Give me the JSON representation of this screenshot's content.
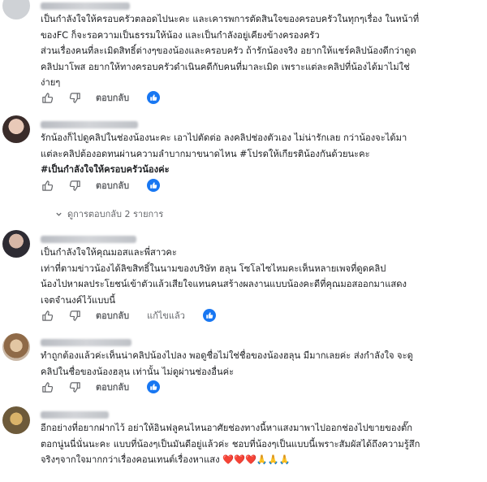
{
  "comments": [
    {
      "lines": [
        {
          "text": "เป็นกำลังใจให้ครอบครัวตลอดไปนะคะ และเคารพการตัดสินใจของครอบครัวในทุกๆเรื่อง ในหน้าที่",
          "bold": false
        },
        {
          "text": "ของFC ก็จะรอความเป็นธรรมให้น้อง และเป็นกำลังอยู่เคียงข้างครองครัว",
          "bold": false
        },
        {
          "text": "ส่วนเรื่องคนที่ละเมิดสิทธิ์ต่างๆของน้องและครอบครัว ถ้ารักน้องจริง อยากให้แชร์คลิปน้องดีกว่าดูด",
          "bold": false
        },
        {
          "text": "คลิปมาโพส อยากให้ทางครอบครัวดำเนินคดีกับคนที่มาละเมิด เพราะแต่ละคลิปที่น้องได้มาไม่ใช่",
          "bold": false
        },
        {
          "text": "ง่ายๆ",
          "bold": false
        }
      ],
      "reply_label": "ตอบกลับ"
    },
    {
      "lines": [
        {
          "text": "รักน้องก็ไปดูคลิปในช่องน้องนะคะ เอาไปตัดต่อ ลงคลิปช่องตัวเอง ไม่น่ารักเลย กว่าน้องจะได้มา",
          "bold": false
        },
        {
          "text": "แต่ละคลิปต้องอดทนผ่านความลำบากมาขนาดไหน #โปรดให้เกียรติน้องกันด้วยนะคะ",
          "bold": false
        },
        {
          "text": "#เป็นกำลังใจให้ครอบครัวน้องค่ะ",
          "bold": true
        }
      ],
      "reply_label": "ตอบกลับ",
      "view_replies": "ดูการตอบกลับ 2 รายการ"
    },
    {
      "lines": [
        {
          "text": "เป็นกำลังใจให้คุณมอสและพี่สาวคะ",
          "bold": false
        },
        {
          "text": "เท่าที่ตามข่าวน้องได้ลิขสิทธิ์ในนามของบริษัท ฮลุน โซโลไซไหมคะเห็นหลายเพจที่ดูดคลิป",
          "bold": false
        },
        {
          "text": "น้องไปหาผลประโยชน์เข้าตัวแล้วเสียใจแทนคนสร้างผลงานแบบน้องคะดีที่คุณมอสออกมาแสดง",
          "bold": false
        },
        {
          "text": "เจตจำนงค์ไว้แบบนี้",
          "bold": false
        }
      ],
      "reply_label": "ตอบกลับ",
      "edited_label": "แก้ไขแล้ว"
    },
    {
      "lines": [
        {
          "text": "ทำถูกต้องแล้วค่ะเห็นน่าคลิปน้องไปลง พอดูชื่อไม่ใช่ชื่อของน้องฮลุน มีมากเลยค่ะ ส่งกำลังใจ จะดู",
          "bold": false
        },
        {
          "text": "คลิปในชื่อของน้องฮลุน เท่านั้น ไม่ดูผ่านช่องอื่นค่ะ",
          "bold": false
        }
      ],
      "reply_label": "ตอบกลับ"
    },
    {
      "lines": [
        {
          "text": "อีกอย่างที่อยากฝากไว้ อย่าให้อินฟลูคนไหนอาศัยช่องทางนี้หาแสงมาพาไปออกช่องไปขายของตั๊ก",
          "bold": false
        },
        {
          "text": "ตอกนู่นนี่นั่นนะคะ แบบที่น้องๆเป็นมันดีอยู่แล้วค่ะ ชอบที่น้องๆเป็นแบบนี้เพราะสัมผัสได้ถึงความรู้สึก",
          "bold": false
        },
        {
          "text": "จริงๆจากใจมากกว่าเรื่องคอนเทนต์เรื่องหาแสง ❤️❤️❤️🙏🙏🙏",
          "bold": false
        }
      ]
    }
  ],
  "colors": {
    "like_blue": "#1877f2",
    "muted_text": "#65676b"
  }
}
